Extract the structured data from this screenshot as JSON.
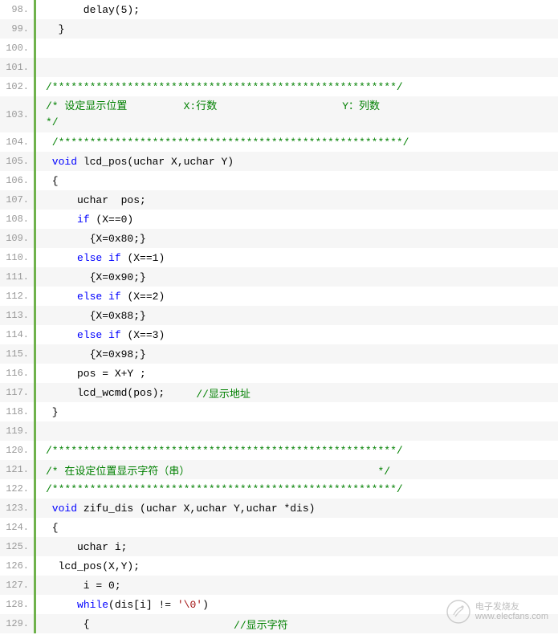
{
  "lines": [
    {
      "num": "98.",
      "alt": false,
      "segs": [
        {
          "cls": "plain",
          "t": "      delay(5);"
        }
      ]
    },
    {
      "num": "99.",
      "alt": true,
      "segs": [
        {
          "cls": "plain",
          "t": "  }"
        }
      ]
    },
    {
      "num": "100.",
      "alt": false,
      "segs": [
        {
          "cls": "plain",
          "t": " "
        }
      ]
    },
    {
      "num": "101.",
      "alt": true,
      "segs": [
        {
          "cls": "plain",
          "t": " "
        }
      ]
    },
    {
      "num": "102.",
      "alt": false,
      "segs": [
        {
          "cls": "cm",
          "t": "/*******************************************************/"
        }
      ]
    },
    {
      "num": "103.",
      "alt": true,
      "wrap": true,
      "segs": [
        {
          "cls": "cm",
          "t": "/* 设定显示位置         X:行数                    Y：列数                                     */"
        }
      ]
    },
    {
      "num": "104.",
      "alt": false,
      "segs": [
        {
          "cls": "cm",
          "t": " /*******************************************************/"
        }
      ]
    },
    {
      "num": "105.",
      "alt": true,
      "segs": [
        {
          "cls": "kw",
          "t": " void"
        },
        {
          "cls": "plain",
          "t": " lcd_pos(uchar X,uchar Y)"
        }
      ]
    },
    {
      "num": "106.",
      "alt": false,
      "segs": [
        {
          "cls": "plain",
          "t": " {                          "
        }
      ]
    },
    {
      "num": "107.",
      "alt": true,
      "segs": [
        {
          "cls": "plain",
          "t": "     uchar  pos;"
        }
      ]
    },
    {
      "num": "108.",
      "alt": false,
      "segs": [
        {
          "cls": "plain",
          "t": "     "
        },
        {
          "cls": "kw",
          "t": "if"
        },
        {
          "cls": "plain",
          "t": " (X==0)"
        }
      ]
    },
    {
      "num": "109.",
      "alt": true,
      "segs": [
        {
          "cls": "plain",
          "t": "       {X=0x80;}"
        }
      ]
    },
    {
      "num": "110.",
      "alt": false,
      "segs": [
        {
          "cls": "plain",
          "t": "     "
        },
        {
          "cls": "kw",
          "t": "else"
        },
        {
          "cls": "plain",
          "t": " "
        },
        {
          "cls": "kw",
          "t": "if"
        },
        {
          "cls": "plain",
          "t": " (X==1)"
        }
      ]
    },
    {
      "num": "111.",
      "alt": true,
      "segs": [
        {
          "cls": "plain",
          "t": "       {X=0x90;}"
        }
      ]
    },
    {
      "num": "112.",
      "alt": false,
      "segs": [
        {
          "cls": "plain",
          "t": "     "
        },
        {
          "cls": "kw",
          "t": "else"
        },
        {
          "cls": "plain",
          "t": " "
        },
        {
          "cls": "kw",
          "t": "if"
        },
        {
          "cls": "plain",
          "t": " (X==2)"
        }
      ]
    },
    {
      "num": "113.",
      "alt": true,
      "segs": [
        {
          "cls": "plain",
          "t": "       {X=0x88;}"
        }
      ]
    },
    {
      "num": "114.",
      "alt": false,
      "segs": [
        {
          "cls": "plain",
          "t": "     "
        },
        {
          "cls": "kw",
          "t": "else"
        },
        {
          "cls": "plain",
          "t": " "
        },
        {
          "cls": "kw",
          "t": "if"
        },
        {
          "cls": "plain",
          "t": " (X==3)"
        }
      ]
    },
    {
      "num": "115.",
      "alt": true,
      "segs": [
        {
          "cls": "plain",
          "t": "       {X=0x98;}"
        }
      ]
    },
    {
      "num": "116.",
      "alt": false,
      "segs": [
        {
          "cls": "plain",
          "t": "     pos = X+Y ;  "
        }
      ]
    },
    {
      "num": "117.",
      "alt": true,
      "segs": [
        {
          "cls": "plain",
          "t": "     lcd_wcmd(pos);     "
        },
        {
          "cls": "cm",
          "t": "//显示地址"
        }
      ]
    },
    {
      "num": "118.",
      "alt": false,
      "segs": [
        {
          "cls": "plain",
          "t": " }"
        }
      ]
    },
    {
      "num": "119.",
      "alt": true,
      "segs": [
        {
          "cls": "plain",
          "t": " "
        }
      ]
    },
    {
      "num": "120.",
      "alt": false,
      "segs": [
        {
          "cls": "cm",
          "t": "/*******************************************************/"
        }
      ]
    },
    {
      "num": "121.",
      "alt": true,
      "segs": [
        {
          "cls": "cm",
          "t": "/* 在设定位置显示字符（串）                              */"
        }
      ]
    },
    {
      "num": "122.",
      "alt": false,
      "segs": [
        {
          "cls": "cm",
          "t": "/*******************************************************/"
        }
      ]
    },
    {
      "num": "123.",
      "alt": true,
      "segs": [
        {
          "cls": "kw",
          "t": " void"
        },
        {
          "cls": "plain",
          "t": " zifu_dis (uchar X,uchar Y,uchar *dis)"
        }
      ]
    },
    {
      "num": "124.",
      "alt": false,
      "segs": [
        {
          "cls": "plain",
          "t": " { "
        }
      ]
    },
    {
      "num": "125.",
      "alt": true,
      "segs": [
        {
          "cls": "plain",
          "t": "     uchar i;"
        }
      ]
    },
    {
      "num": "126.",
      "alt": false,
      "segs": [
        {
          "cls": "plain",
          "t": "  lcd_pos(X,Y);"
        }
      ]
    },
    {
      "num": "127.",
      "alt": true,
      "segs": [
        {
          "cls": "plain",
          "t": "      i = 0;"
        }
      ]
    },
    {
      "num": "128.",
      "alt": false,
      "segs": [
        {
          "cls": "plain",
          "t": "     "
        },
        {
          "cls": "kw",
          "t": "while"
        },
        {
          "cls": "plain",
          "t": "(dis[i] != "
        },
        {
          "cls": "str",
          "t": "'\\0'"
        },
        {
          "cls": "plain",
          "t": ")"
        }
      ]
    },
    {
      "num": "129.",
      "alt": true,
      "segs": [
        {
          "cls": "plain",
          "t": "      {                       "
        },
        {
          "cls": "cm",
          "t": "//显示字符"
        }
      ]
    }
  ],
  "watermark": {
    "brand": "电子发烧友",
    "url": "www.elecfans.com"
  }
}
